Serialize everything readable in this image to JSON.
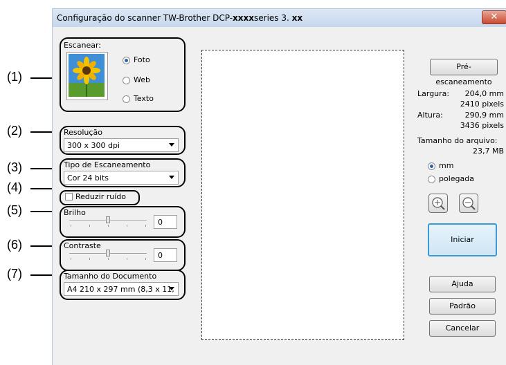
{
  "window": {
    "title_prefix": "Configuração do scanner TW-Brother DCP-",
    "title_bold": "xxxx",
    "title_mid": "series 3. ",
    "title_end": "xx",
    "close_glyph": "✕"
  },
  "scan": {
    "label": "Escanear:",
    "options": [
      {
        "label": "Foto",
        "selected": true
      },
      {
        "label": "Web",
        "selected": false
      },
      {
        "label": "Texto",
        "selected": false
      }
    ]
  },
  "resolution": {
    "label": "Resolução",
    "value": "300 x 300 dpi"
  },
  "scan_type": {
    "label": "Tipo de Escaneamento",
    "value": "Cor 24 bits"
  },
  "noise": {
    "label": "Reduzir ruído",
    "checked": false
  },
  "brightness": {
    "label": "Brilho",
    "value": "0"
  },
  "contrast": {
    "label": "Contraste",
    "value": "0"
  },
  "doc_size": {
    "label": "Tamanho do Documento",
    "value": "A4 210 x 297 mm (8,3 x 11,"
  },
  "right_panel": {
    "prescan_button": "Pré-escaneamento",
    "width_label": "Largura:",
    "width_mm": "204,0 mm",
    "width_px": "2410 pixels",
    "height_label": "Altura:",
    "height_mm": "290,9 mm",
    "height_px": "3436 pixels",
    "file_size_label": "Tamanho do arquivo:",
    "file_size_value": "23,7 MB",
    "unit_mm": "mm",
    "unit_inch": "polegada",
    "unit_selected": "mm",
    "start_button": "Iniciar",
    "help_button": "Ajuda",
    "default_button": "Padrão",
    "cancel_button": "Cancelar"
  },
  "callouts": [
    "(1)",
    "(2)",
    "(3)",
    "(4)",
    "(5)",
    "(6)",
    "(7)"
  ],
  "colors": {
    "accent": "#2f5fb0",
    "start_border": "#3c9bd6",
    "start_fill": "#cfe6f5",
    "title_bar": "#c7d7ec"
  }
}
